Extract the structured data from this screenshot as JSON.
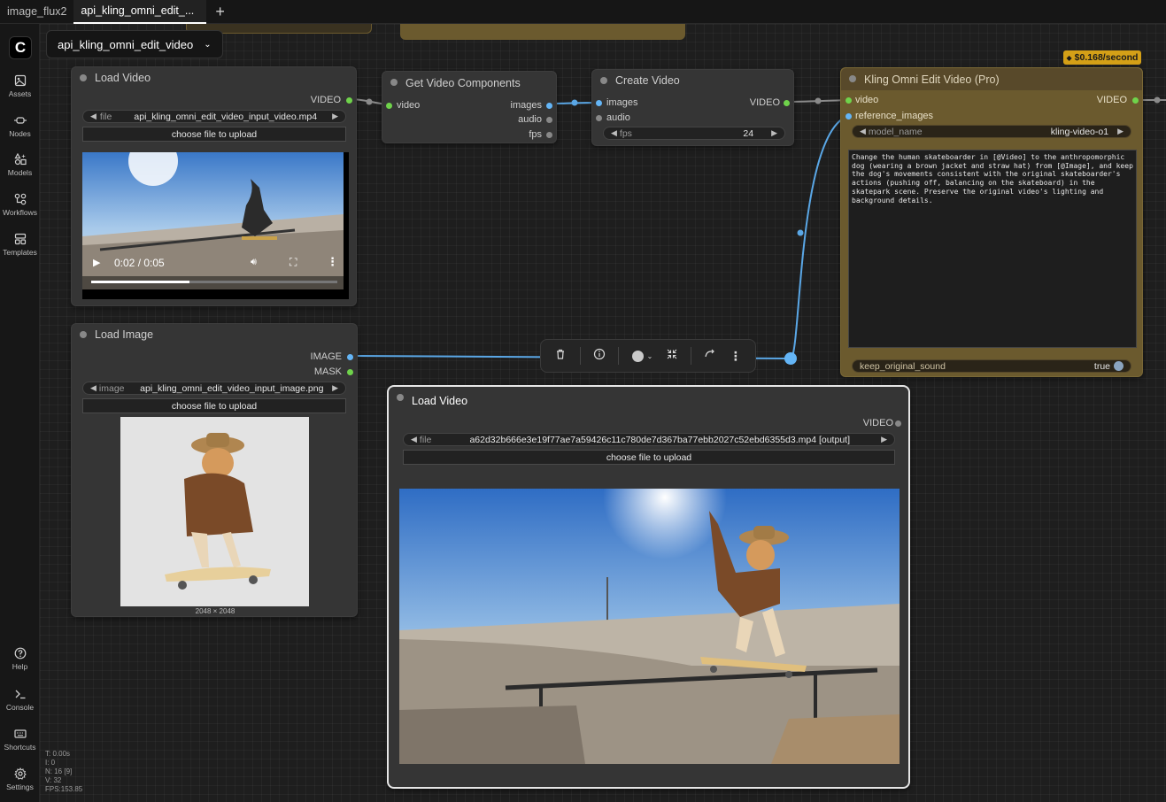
{
  "tabs": [
    {
      "label": "image_flux2",
      "active": false
    },
    {
      "label": "api_kling_omni_edit_...",
      "active": true
    }
  ],
  "workflow_title": "api_kling_omni_edit_video",
  "sidebar": {
    "logo": "C",
    "items": [
      {
        "label": "Assets",
        "icon": "image-icon"
      },
      {
        "label": "Nodes",
        "icon": "node-icon"
      },
      {
        "label": "Models",
        "icon": "models-icon"
      },
      {
        "label": "Workflows",
        "icon": "workflow-icon"
      },
      {
        "label": "Templates",
        "icon": "templates-icon"
      }
    ],
    "bottom_items": [
      {
        "label": "Help",
        "icon": "help-icon"
      },
      {
        "label": "Console",
        "icon": "console-icon"
      },
      {
        "label": "Shortcuts",
        "icon": "keyboard-icon"
      },
      {
        "label": "Settings",
        "icon": "gear-icon"
      }
    ]
  },
  "stats": [
    "T: 0.00s",
    "I: 0",
    "N: 16 [9]",
    "V: 32",
    "FPS:153.85"
  ],
  "nodes": {
    "load_video_1": {
      "title": "Load Video",
      "output": "VIDEO",
      "file_label": "file",
      "file_value": "api_kling_omni_edit_video_input_video.mp4",
      "upload": "choose file to upload",
      "time": "0:02 / 0:05",
      "progress": 0.4
    },
    "get_components": {
      "title": "Get Video Components",
      "input": "video",
      "outputs": [
        "images",
        "audio",
        "fps"
      ]
    },
    "create_video": {
      "title": "Create Video",
      "inputs": [
        "images",
        "audio"
      ],
      "output": "VIDEO",
      "fps_label": "fps",
      "fps_value": "24"
    },
    "kling": {
      "title": "Kling Omni Edit Video (Pro)",
      "price": "$0.168/second",
      "inputs": [
        "video",
        "reference_images"
      ],
      "output": "VIDEO",
      "model_label": "model_name",
      "model_value": "kling-video-o1",
      "prompt": "Change the human skateboarder in [@Video] to the anthropomorphic dog (wearing a brown jacket and straw hat) from [@Image], and keep the dog's movements consistent with the original skateboarder's actions (pushing off, balancing on the skateboard) in the skatepark scene. Preserve the original video's lighting and background details.",
      "sound_label": "keep_original_sound",
      "sound_value": "true"
    },
    "load_image": {
      "title": "Load Image",
      "outputs": [
        "IMAGE",
        "MASK"
      ],
      "file_label": "image",
      "file_value": "api_kling_omni_edit_video_input_image.png",
      "upload": "choose file to upload",
      "size": "2048 × 2048"
    },
    "load_video_2": {
      "title": "Load Video",
      "output": "VIDEO",
      "file_label": "file",
      "file_value": "a62d32b666e3e19f77ae7a59426c11c780de7d367ba77ebb2027c52ebd6355d3.mp4 [output]",
      "upload": "choose file to upload"
    }
  },
  "colors": {
    "video_port": "#6fd34b",
    "image_port": "#64b5f6",
    "wire_blue": "#5aa7e6",
    "wire_gray": "#8a8a8a",
    "kling_body": "#6b5a2e",
    "kling_head": "#58492a",
    "price_badge": "#d4a017"
  }
}
